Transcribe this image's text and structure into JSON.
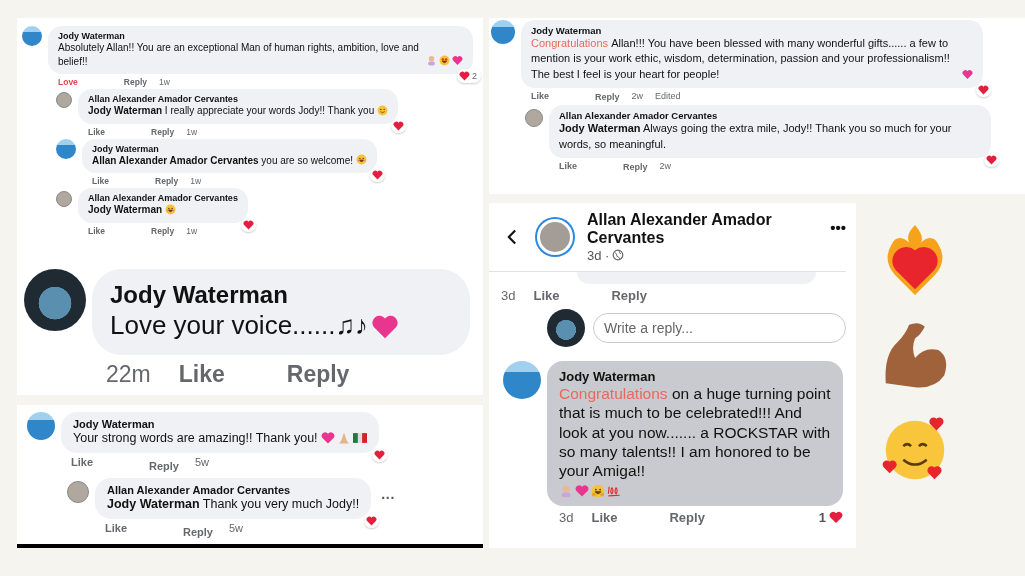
{
  "panels": [
    {
      "comments": [
        {
          "author": "Jody Waterman",
          "avatar": {
            "kind": "sea"
          },
          "highlighted": false,
          "text": "Absolutely Allan!! You are an exceptional Man of human rights, ambition, love and belief!!",
          "emojis": [
            {
              "kind": "person"
            },
            {
              "kind": "starstruck"
            },
            {
              "kind": "heart"
            }
          ],
          "reaction": {
            "beside_actions": false,
            "count": "2"
          },
          "actions": [
            {
              "kind": "like",
              "label": "Love",
              "on": true
            },
            {
              "kind": "reply",
              "label": "Reply"
            },
            {
              "kind": "time",
              "label": "1w"
            }
          ],
          "replies": [
            {
              "author": "Allan Alexander Amador Cervantes",
              "avatar": {
                "kind": "portrait"
              },
              "highlighted": false,
              "text": "**Jody Waterman** I really appreciate your words Jody!! Thank you",
              "emojis": [
                {
                  "kind": "smile"
                }
              ],
              "reaction": {
                "beside_actions": false
              },
              "actions": [
                {
                  "kind": "like",
                  "label": "Like",
                  "on": false
                },
                {
                  "kind": "reply",
                  "label": "Reply"
                },
                {
                  "kind": "time",
                  "label": "1w"
                }
              ]
            },
            {
              "author": "Jody Waterman",
              "avatar": {
                "kind": "sea"
              },
              "highlighted": false,
              "text": "**Allan Alexander Amador Cervantes** you are so welcome!",
              "emojis": [
                {
                  "kind": "blush"
                }
              ],
              "reaction": {
                "beside_actions": false
              },
              "actions": [
                {
                  "kind": "like",
                  "label": "Like",
                  "on": false
                },
                {
                  "kind": "reply",
                  "label": "Reply"
                },
                {
                  "kind": "time",
                  "label": "1w"
                }
              ]
            },
            {
              "author": "Allan Alexander Amador Cervantes",
              "avatar": {
                "kind": "portrait"
              },
              "highlighted": false,
              "text": "**Jody Waterman**",
              "emojis": [
                {
                  "kind": "blush"
                }
              ],
              "reaction": {
                "beside_actions": false
              },
              "actions": [
                {
                  "kind": "like",
                  "label": "Like",
                  "on": false
                },
                {
                  "kind": "reply",
                  "label": "Reply"
                },
                {
                  "kind": "time",
                  "label": "1w"
                }
              ]
            }
          ]
        }
      ]
    },
    {
      "comments": [
        {
          "author": "Jody Waterman",
          "avatar": {
            "kind": "group"
          },
          "highlighted": false,
          "text": "Love your voice......♫♪",
          "emojis": [
            {
              "kind": "heart"
            }
          ],
          "actions": [
            {
              "kind": "time",
              "label": "22m"
            },
            {
              "kind": "like",
              "label": "Like",
              "on": false
            },
            {
              "kind": "reply",
              "label": "Reply"
            }
          ]
        }
      ]
    },
    {
      "comments": [
        {
          "author": "Jody Waterman",
          "avatar": {
            "kind": "sea"
          },
          "highlighted": false,
          "text": "Your strong words are amazing!! Thank you!",
          "emojis": [
            {
              "kind": "heart"
            },
            {
              "kind": "pray"
            },
            {
              "kind": "flag"
            }
          ],
          "reaction": {
            "beside_actions": false
          },
          "actions": [
            {
              "kind": "like",
              "label": "Like",
              "on": false
            },
            {
              "kind": "reply",
              "label": "Reply"
            },
            {
              "kind": "time",
              "label": "5w"
            }
          ],
          "replies": [
            {
              "author": "Allan Alexander Amador Cervantes",
              "avatar": {
                "kind": "portrait"
              },
              "highlighted": false,
              "text": "**Jody Waterman** Thank you very much Jody!!",
              "menu": "···",
              "reaction": {
                "beside_actions": false
              },
              "actions": [
                {
                  "kind": "like",
                  "label": "Like",
                  "on": false
                },
                {
                  "kind": "reply",
                  "label": "Reply"
                },
                {
                  "kind": "time",
                  "label": "5w"
                }
              ]
            }
          ]
        }
      ]
    },
    {
      "comments": [
        {
          "author": "Jody Waterman",
          "avatar": {
            "kind": "sea"
          },
          "highlighted": false,
          "highlight": "Congratulations",
          "text": "Allan!!! You have been blessed with many wonderful gifts...... a few to mention is your work ethic, wisdom, determination, passion and your professionalism!!\nThe best I feel is your heart for people!",
          "emojis": [
            {
              "kind": "heart"
            }
          ],
          "reaction": {
            "beside_actions": false
          },
          "actions": [
            {
              "kind": "like",
              "label": "Like",
              "on": false
            },
            {
              "kind": "reply",
              "label": "Reply"
            },
            {
              "kind": "time",
              "label": "2w"
            },
            {
              "kind": "note",
              "label": "Edited"
            }
          ],
          "replies": [
            {
              "author": "Allan Alexander Amador Cervantes",
              "avatar": {
                "kind": "portrait"
              },
              "highlighted": false,
              "text": "**Jody Waterman** Always going the extra mile, Jody!! Thank you so much for your words, so meaningful.",
              "reaction": {
                "beside_actions": false
              },
              "actions": [
                {
                  "kind": "like",
                  "label": "Like",
                  "on": false
                },
                {
                  "kind": "reply",
                  "label": "Reply"
                },
                {
                  "kind": "time",
                  "label": "2w"
                }
              ]
            }
          ]
        }
      ]
    },
    {
      "header": {
        "name": "Allan Alexander Amador Cervantes",
        "time": "3d ·",
        "menu": "•••"
      },
      "previous_actions": [
        {
          "kind": "time",
          "label": "3d"
        },
        {
          "kind": "like",
          "label": "Like",
          "on": false
        },
        {
          "kind": "reply",
          "label": "Reply"
        }
      ],
      "reply_field": {
        "placeholder": "Write a reply..."
      },
      "comments": [
        {
          "author": "Jody Waterman",
          "avatar": {
            "kind": "sea"
          },
          "highlighted": true,
          "highlight": "Congratulations",
          "text": "on a huge turning point that is much to be celebrated!!! And look at you now....... a ROCKSTAR with so many talents!! I am honored to be your Amiga!!",
          "emojis": [
            {
              "kind": "person"
            },
            {
              "kind": "heart"
            },
            {
              "kind": "hug"
            },
            {
              "kind": "hundred"
            }
          ],
          "reaction": {
            "beside_actions": true,
            "count": "1"
          },
          "actions": [
            {
              "kind": "time",
              "label": "3d"
            },
            {
              "kind": "like",
              "label": "Like",
              "on": false
            },
            {
              "kind": "reply",
              "label": "Reply"
            }
          ]
        }
      ]
    }
  ],
  "stickers": [
    {
      "kind": "heart-fire"
    },
    {
      "kind": "flexed-arm"
    },
    {
      "kind": "face-hearts"
    }
  ]
}
